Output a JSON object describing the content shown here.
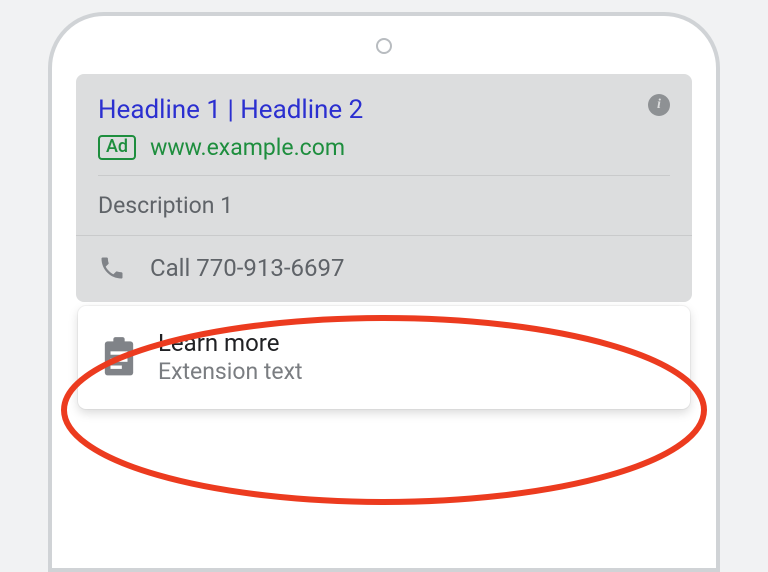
{
  "ad": {
    "headline": "Headline 1 | Headline 2",
    "badge": "Ad",
    "display_url": "www.example.com",
    "description": "Description 1",
    "call_label": "Call 770-913-6697"
  },
  "extension": {
    "title": "Learn more",
    "subtitle": "Extension text"
  },
  "icons": {
    "info": "info-icon",
    "phone": "phone-icon",
    "clipboard": "clipboard-icon"
  },
  "colors": {
    "headline": "#2b2fd0",
    "green": "#1e8e3e",
    "muted": "#5f6368",
    "annotation": "#ec3b1f"
  }
}
